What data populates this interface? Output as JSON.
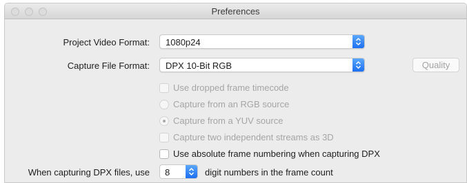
{
  "window": {
    "title": "Preferences"
  },
  "project_video_format": {
    "label": "Project Video Format:",
    "value": "1080p24"
  },
  "capture_file_format": {
    "label": "Capture File Format:",
    "value": "DPX 10-Bit RGB",
    "quality_button": "Quality"
  },
  "options": [
    {
      "label": "Use dropped frame timecode",
      "type": "checkbox",
      "checked": false,
      "enabled": false
    },
    {
      "label": "Capture from an RGB source",
      "type": "radio",
      "checked": false,
      "enabled": false
    },
    {
      "label": "Capture from a YUV source",
      "type": "radio",
      "checked": true,
      "enabled": false
    },
    {
      "label": "Capture two independent streams as 3D",
      "type": "checkbox",
      "checked": false,
      "enabled": false
    },
    {
      "label": "Use absolute frame numbering when capturing DPX",
      "type": "checkbox",
      "checked": false,
      "enabled": true
    }
  ],
  "dpx_digits": {
    "prefix": "When capturing DPX files, use",
    "value": "8",
    "suffix": "digit numbers in the frame count"
  },
  "colors": {
    "accent": "#1d6ff2",
    "window_bg": "#ececec"
  }
}
